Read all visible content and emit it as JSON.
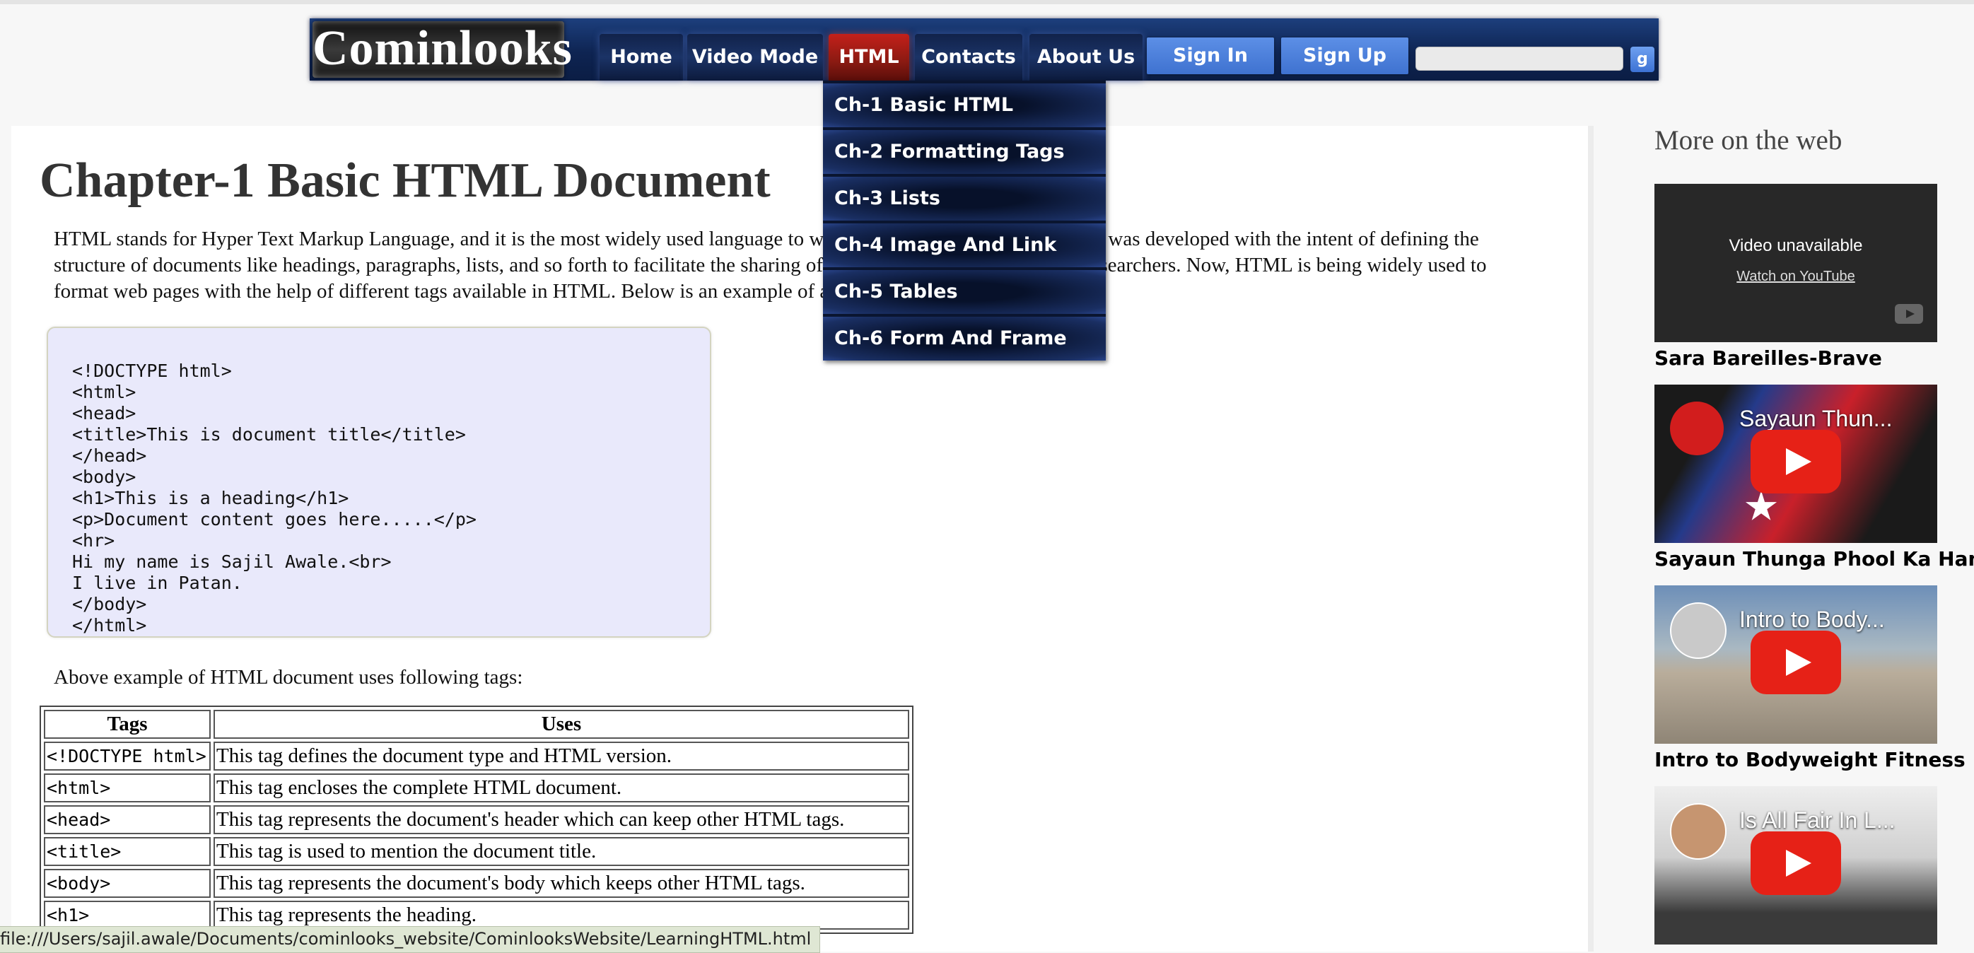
{
  "header": {
    "logo": "Cominlooks",
    "nav": [
      {
        "label": "Home"
      },
      {
        "label": "Video Mode"
      },
      {
        "label": "HTML"
      },
      {
        "label": "Contacts"
      },
      {
        "label": "About Us"
      }
    ],
    "sign_in": "Sign In",
    "sign_up": "Sign Up",
    "search_value": "",
    "search_button": "g"
  },
  "dropdown": {
    "items": [
      "Ch-1 Basic HTML",
      "Ch-2 Formatting Tags",
      "Ch-3 Lists",
      "Ch-4 Image And Link",
      "Ch-5 Tables",
      "Ch-6 Form And Frame"
    ]
  },
  "main": {
    "title": "Chapter-1 Basic HTML Document",
    "intro": "HTML stands for Hyper Text Markup Language, and it is the most widely used language to write web pages. Originally, HTML was developed with the intent of defining the structure of documents like headings, paragraphs, lists, and so forth to facilitate the sharing of scientific information between researchers. Now, HTML is being widely used to format web pages with the help of different tags available in HTML. Below is an example of an HTML document.",
    "code": "<!DOCTYPE html>\n<html>\n<head>\n<title>This is document title</title>\n</head>\n<body>\n<h1>This is a heading</h1>\n<p>Document content goes here.....</p>\n<hr>\nHi my name is Sajil Awale.<br>\nI live in Patan.\n</body>\n</html>",
    "tags_caption": "Above example of HTML document uses following tags:",
    "table": {
      "headers": [
        "Tags",
        "Uses"
      ],
      "rows": [
        {
          "tag": "<!DOCTYPE html>",
          "use": "This tag defines the document type and HTML version."
        },
        {
          "tag": "<html>",
          "use": "This tag encloses the complete HTML document."
        },
        {
          "tag": "<head>",
          "use": "This tag represents the document's header which can keep other HTML tags."
        },
        {
          "tag": "<title>",
          "use": "This tag is used to mention the document title."
        },
        {
          "tag": "<body>",
          "use": "This tag represents the document's body which keeps other HTML tags."
        },
        {
          "tag": "<h1>",
          "use": "This tag represents the heading."
        }
      ]
    }
  },
  "sidebar": {
    "title": "More on the web",
    "videos": [
      {
        "caption": "Sara Bareilles-Brave",
        "unavailable": "Video unavailable",
        "watch_link": "Watch on YouTube"
      },
      {
        "caption": "Sayaun Thunga Phool Ka Hami",
        "thumb_title": "Sayaun Thun..."
      },
      {
        "caption": "Intro to Bodyweight Fitness",
        "thumb_title": "Intro to Body..."
      },
      {
        "caption": "",
        "thumb_title": "Is All Fair In L..."
      }
    ]
  },
  "status_bar": {
    "url": "file:///Users/sajil.awale/Documents/cominlooks_website/CominlooksWebsite/LearningHTML.html"
  },
  "colors": {
    "nav_bg": "#0e2452",
    "nav_active": "#a8211a",
    "auth_button": "#4a80dc",
    "code_bg": "#e9e9fb",
    "play_button": "#e62117"
  }
}
